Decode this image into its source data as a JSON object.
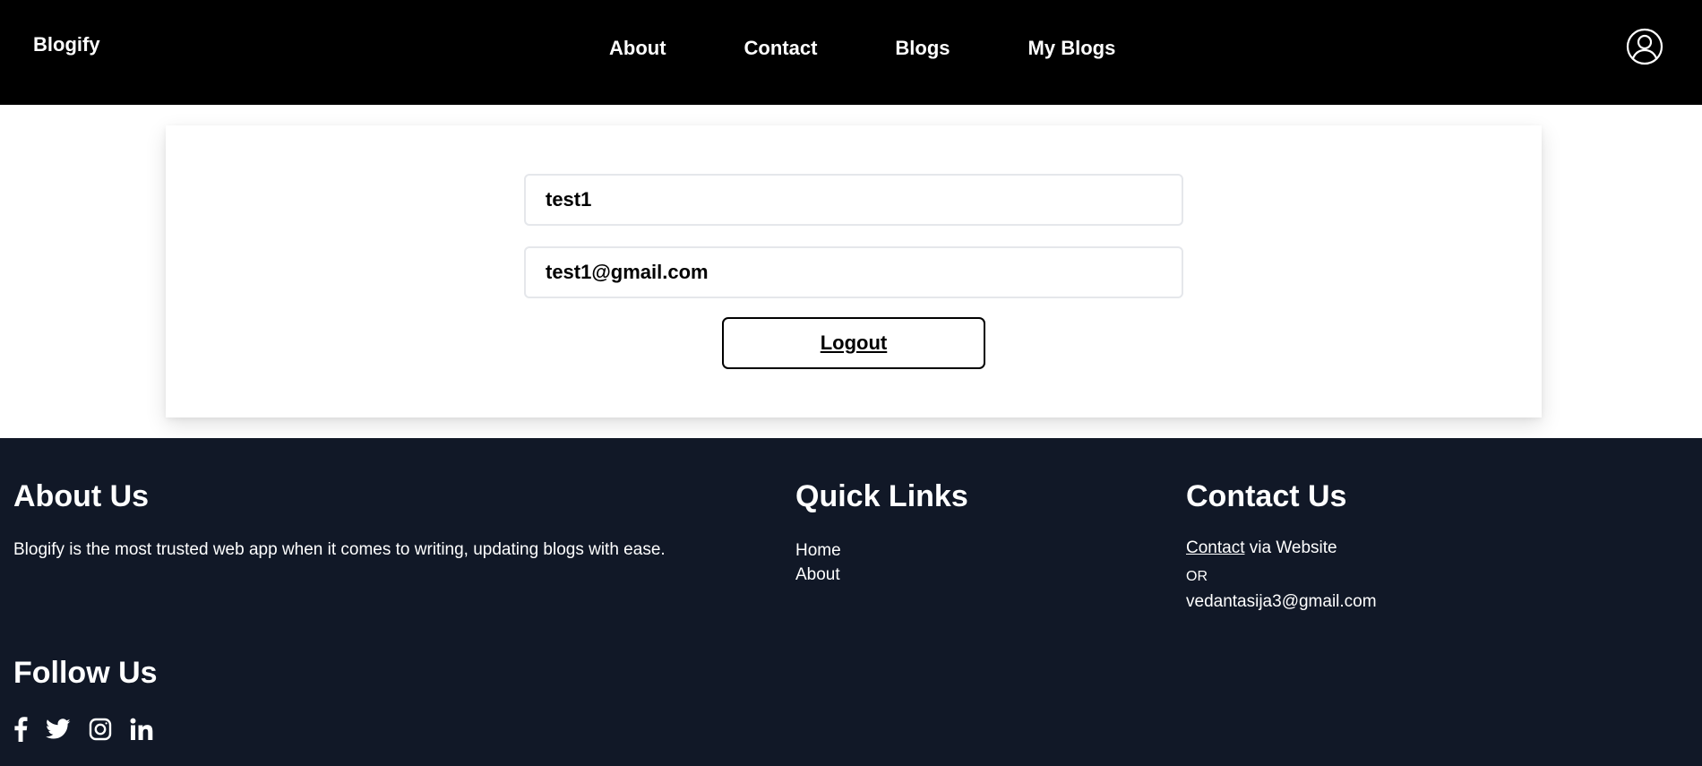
{
  "nav": {
    "brand": "Blogify",
    "links": [
      "About",
      "Contact",
      "Blogs",
      "My Blogs"
    ],
    "account_icon": "user-circle-icon"
  },
  "profile": {
    "username": "test1",
    "email": "test1@gmail.com",
    "logout_label": "Logout"
  },
  "footer": {
    "about": {
      "heading": "About Us",
      "text": "Blogify is the most trusted web app when it comes to writing, updating blogs with ease."
    },
    "quick_links": {
      "heading": "Quick Links",
      "items": [
        "Home",
        "About"
      ]
    },
    "contact": {
      "heading": "Contact Us",
      "link_label": "Contact",
      "suffix": " via Website",
      "or": "OR",
      "email": "vedantasija3@gmail.com"
    },
    "follow": {
      "heading": "Follow Us",
      "icons": [
        "facebook-icon",
        "twitter-icon",
        "instagram-icon",
        "linkedin-icon"
      ]
    }
  },
  "colors": {
    "navbar_bg": "#000000",
    "footer_bg": "#111827",
    "page_bg": "#ffffff"
  }
}
